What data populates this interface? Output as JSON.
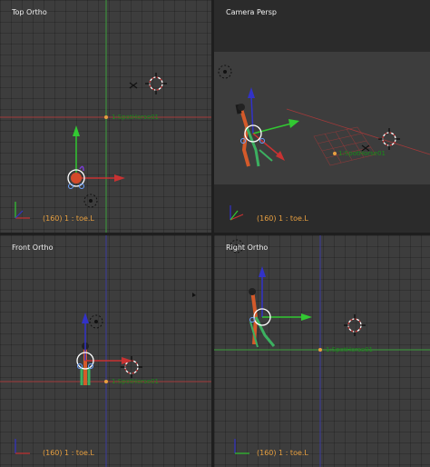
{
  "viewports": {
    "top_left": {
      "title": "Top Ortho",
      "status": "(160) 1 : toe.L",
      "object_label": "1:SpotHorse01"
    },
    "top_right": {
      "title": "Camera Persp",
      "status": "(160) 1 : toe.L",
      "object_label": "1:SpotHorse01"
    },
    "bottom_left": {
      "title": "Front Ortho",
      "status": "(160) 1 : toe.L",
      "object_label": "1:SpotHorse01"
    },
    "bottom_right": {
      "title": "Right Ortho",
      "status": "(160) 1 : toe.L",
      "object_label": "1:SpotHorse01"
    }
  },
  "colors": {
    "background": "#3d3d3d",
    "divider": "#1e1e1e",
    "x_axis": "#c83232",
    "y_axis": "#32c832",
    "z_axis": "#3232c8",
    "status_text": "#e8a040",
    "title_text": "#f0f0f0"
  },
  "icons": [
    "3d-cursor-icon",
    "camera-icon",
    "lamp-icon",
    "axis-gizmo-icon",
    "transform-manipulator-icon"
  ]
}
